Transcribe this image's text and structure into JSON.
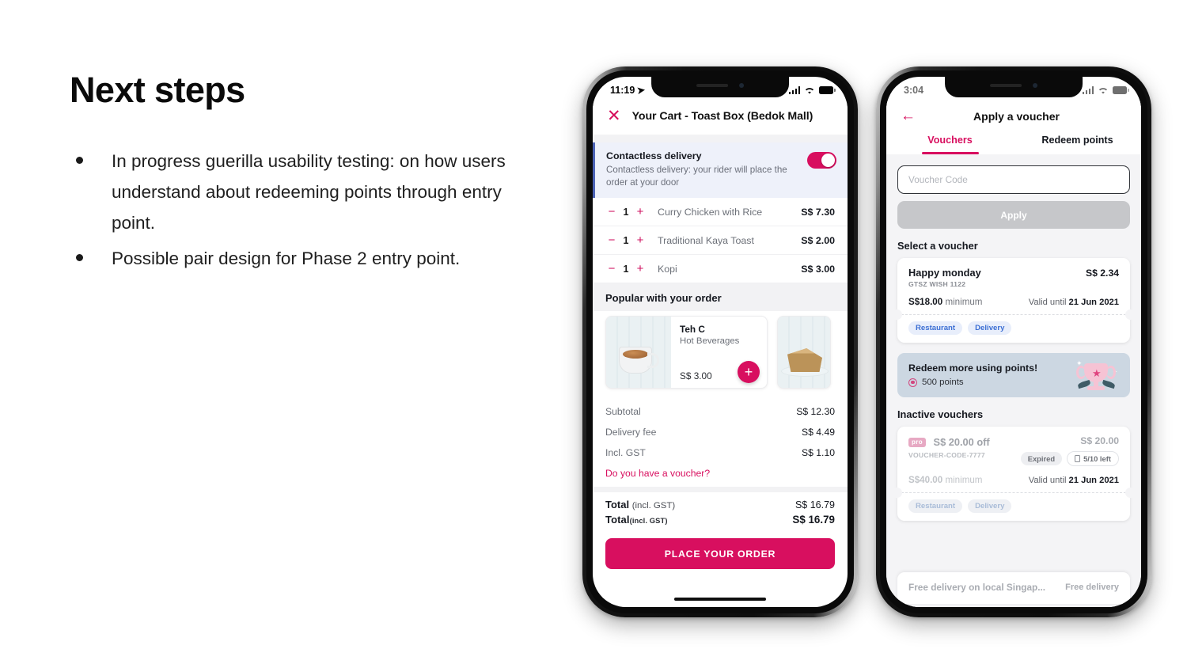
{
  "slide": {
    "title": "Next steps",
    "bullets": [
      "In progress guerilla usability testing: on how users understand about redeeming points through entry point.",
      "Possible pair design for Phase 2 entry point."
    ]
  },
  "colors": {
    "brand_pink": "#d80f5f",
    "link_pink": "#d60e5c",
    "chip_blue_bg": "#e8eefb",
    "chip_blue_text": "#3c6fd4",
    "banner_bg": "#ccd7e2",
    "contactless_bg": "#eef1fa",
    "contactless_accent": "#4c63b6",
    "disabled_button": "#c6c7ca"
  },
  "phone_cart": {
    "status_bar": {
      "time": "11:19",
      "location_icon": "location-arrow-icon",
      "signal_icon": "cellular-bars-icon",
      "wifi_icon": "wifi-icon",
      "battery_icon": "battery-full-icon"
    },
    "header": {
      "close_icon": "close-icon",
      "title": "Your Cart - Toast Box (Bedok Mall)"
    },
    "contactless": {
      "title": "Contactless delivery",
      "description": "Contactless delivery: your rider will place the order at your door",
      "toggle_state": "on"
    },
    "items": [
      {
        "decrement": "−",
        "qty": "1",
        "increment": "+",
        "name": "Curry Chicken with Rice",
        "price": "S$ 7.30"
      },
      {
        "decrement": "−",
        "qty": "1",
        "increment": "+",
        "name": "Traditional Kaya Toast",
        "price": "S$ 2.00"
      },
      {
        "decrement": "−",
        "qty": "1",
        "increment": "+",
        "name": "Kopi",
        "price": "S$ 3.00"
      }
    ],
    "popular": {
      "heading": "Popular with your order",
      "products": [
        {
          "name": "Teh C",
          "category": "Hot Beverages",
          "price": "S$ 3.00",
          "add_label": "+",
          "image": "tea-mug-photo"
        },
        {
          "image": "cake-slice-photo"
        }
      ]
    },
    "totals": [
      {
        "label": "Subtotal",
        "value": "S$ 12.30"
      },
      {
        "label": "Delivery fee",
        "value": "S$ 4.49"
      },
      {
        "label": "Incl. GST",
        "value": "S$ 1.10"
      }
    ],
    "voucher_link": "Do you have a voucher?",
    "grand_total_1": {
      "label": "Total",
      "note": "(incl. GST)",
      "value": "S$ 16.79"
    },
    "grand_total_2": {
      "label": "Total",
      "note": "(incl. GST)",
      "value": "S$ 16.79"
    },
    "cta_label": "PLACE YOUR ORDER"
  },
  "phone_voucher": {
    "status_bar": {
      "time": "3:04",
      "signal_icon": "cellular-bars-icon",
      "wifi_icon": "wifi-icon",
      "battery_icon": "battery-full-icon"
    },
    "header": {
      "back_icon": "back-arrow-icon",
      "title": "Apply a voucher"
    },
    "tabs": [
      {
        "label": "Vouchers",
        "active": true
      },
      {
        "label": "Redeem points",
        "active": false
      }
    ],
    "code_input_placeholder": "Voucher Code",
    "apply_label": "Apply",
    "select_heading": "Select a voucher",
    "active_voucher": {
      "name": "Happy monday",
      "amount": "S$ 2.34",
      "code": "GTSZ WISH 1122",
      "minimum_value": "S$18.00",
      "minimum_label": "minimum",
      "valid_prefix": "Valid until",
      "valid_date": "21 Jun 2021",
      "chips": [
        "Restaurant",
        "Delivery"
      ]
    },
    "redeem_banner": {
      "title": "Redeem more using points!",
      "points": "500 points",
      "points_icon": "points-circle-icon",
      "illustration": "trophy-icon"
    },
    "inactive_heading": "Inactive vouchers",
    "inactive_voucher": {
      "badge": "pro",
      "name": "S$ 20.00 off",
      "amount": "S$ 20.00",
      "code": "VOUCHER-CODE-7777",
      "status_chip": "Expired",
      "remaining_chip": "5/10 left",
      "remaining_icon": "ticket-icon",
      "minimum_value": "S$40.00",
      "minimum_label": "minimum",
      "valid_prefix": "Valid until",
      "valid_date": "21 Jun 2021",
      "chips": [
        "Restaurant",
        "Delivery"
      ]
    },
    "bottom_card": {
      "title": "Free delivery on local Singap...",
      "tag": "Free delivery"
    }
  }
}
